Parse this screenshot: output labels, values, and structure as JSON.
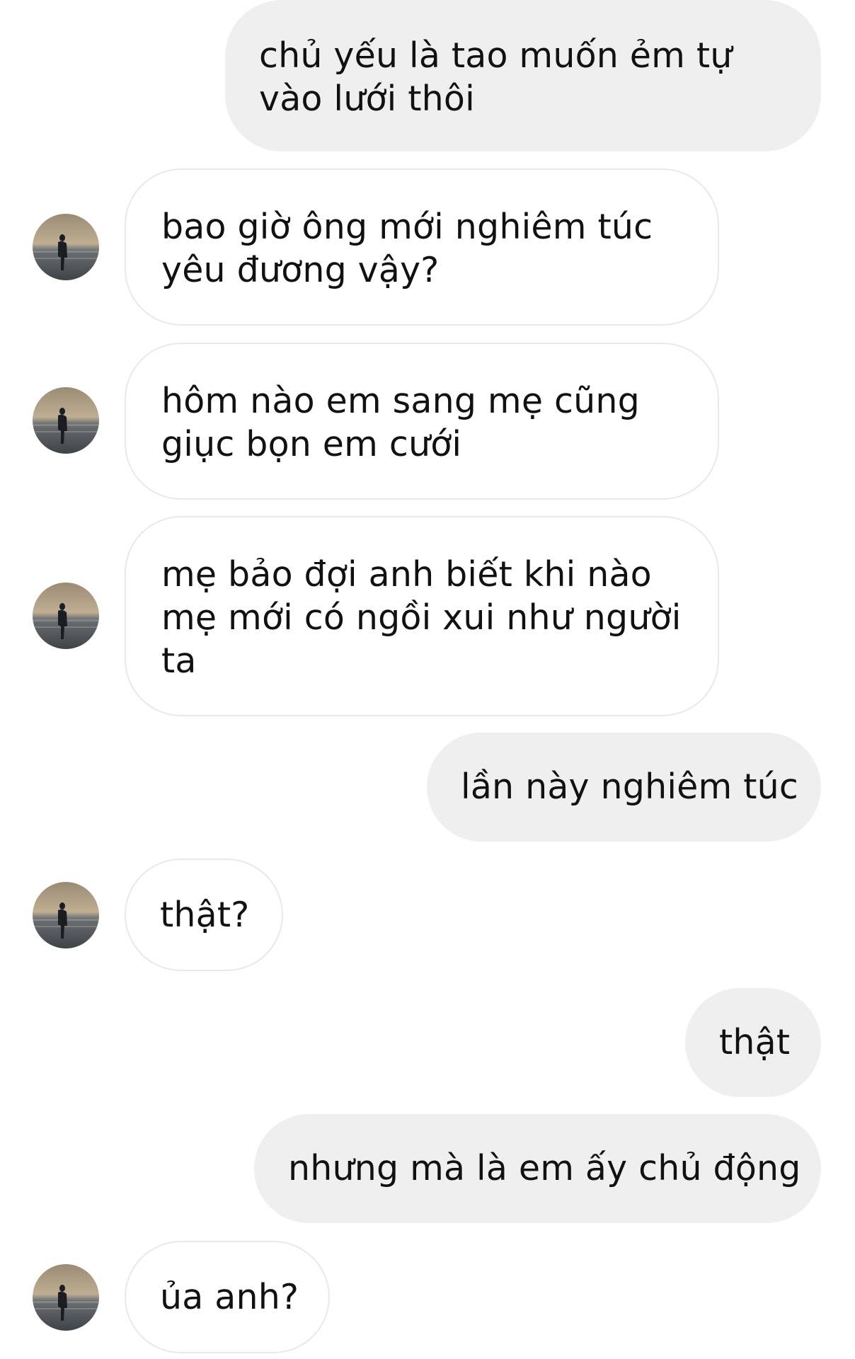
{
  "colors": {
    "outgoing_bubble": "#efefef",
    "incoming_border": "#e9e9e9",
    "text": "#111111"
  },
  "messages": [
    {
      "sender": "me",
      "lines": [
        "chủ yếu là tao muốn ẻm tự",
        "vào lưới thôi"
      ]
    },
    {
      "sender": "other",
      "lines": [
        "bao giờ ông mới nghiêm túc",
        "yêu đương vậy?"
      ],
      "avatar_icon": "avatar-icon"
    },
    {
      "sender": "other",
      "lines": [
        "hôm nào em sang mẹ cũng",
        "giục bọn em cưới"
      ],
      "avatar_icon": "avatar-icon"
    },
    {
      "sender": "other",
      "lines": [
        "mẹ bảo đợi anh biết khi nào",
        "mẹ mới có ngồi xui như người",
        "ta"
      ],
      "avatar_icon": "avatar-icon"
    },
    {
      "sender": "me",
      "lines": [
        "lần này nghiêm túc"
      ]
    },
    {
      "sender": "other",
      "lines": [
        "thật?"
      ],
      "avatar_icon": "avatar-icon"
    },
    {
      "sender": "me",
      "lines": [
        "thật"
      ]
    },
    {
      "sender": "me",
      "lines": [
        "nhưng mà là em ấy chủ động"
      ]
    },
    {
      "sender": "other",
      "lines": [
        "ủa anh?"
      ],
      "avatar_icon": "avatar-icon"
    }
  ]
}
